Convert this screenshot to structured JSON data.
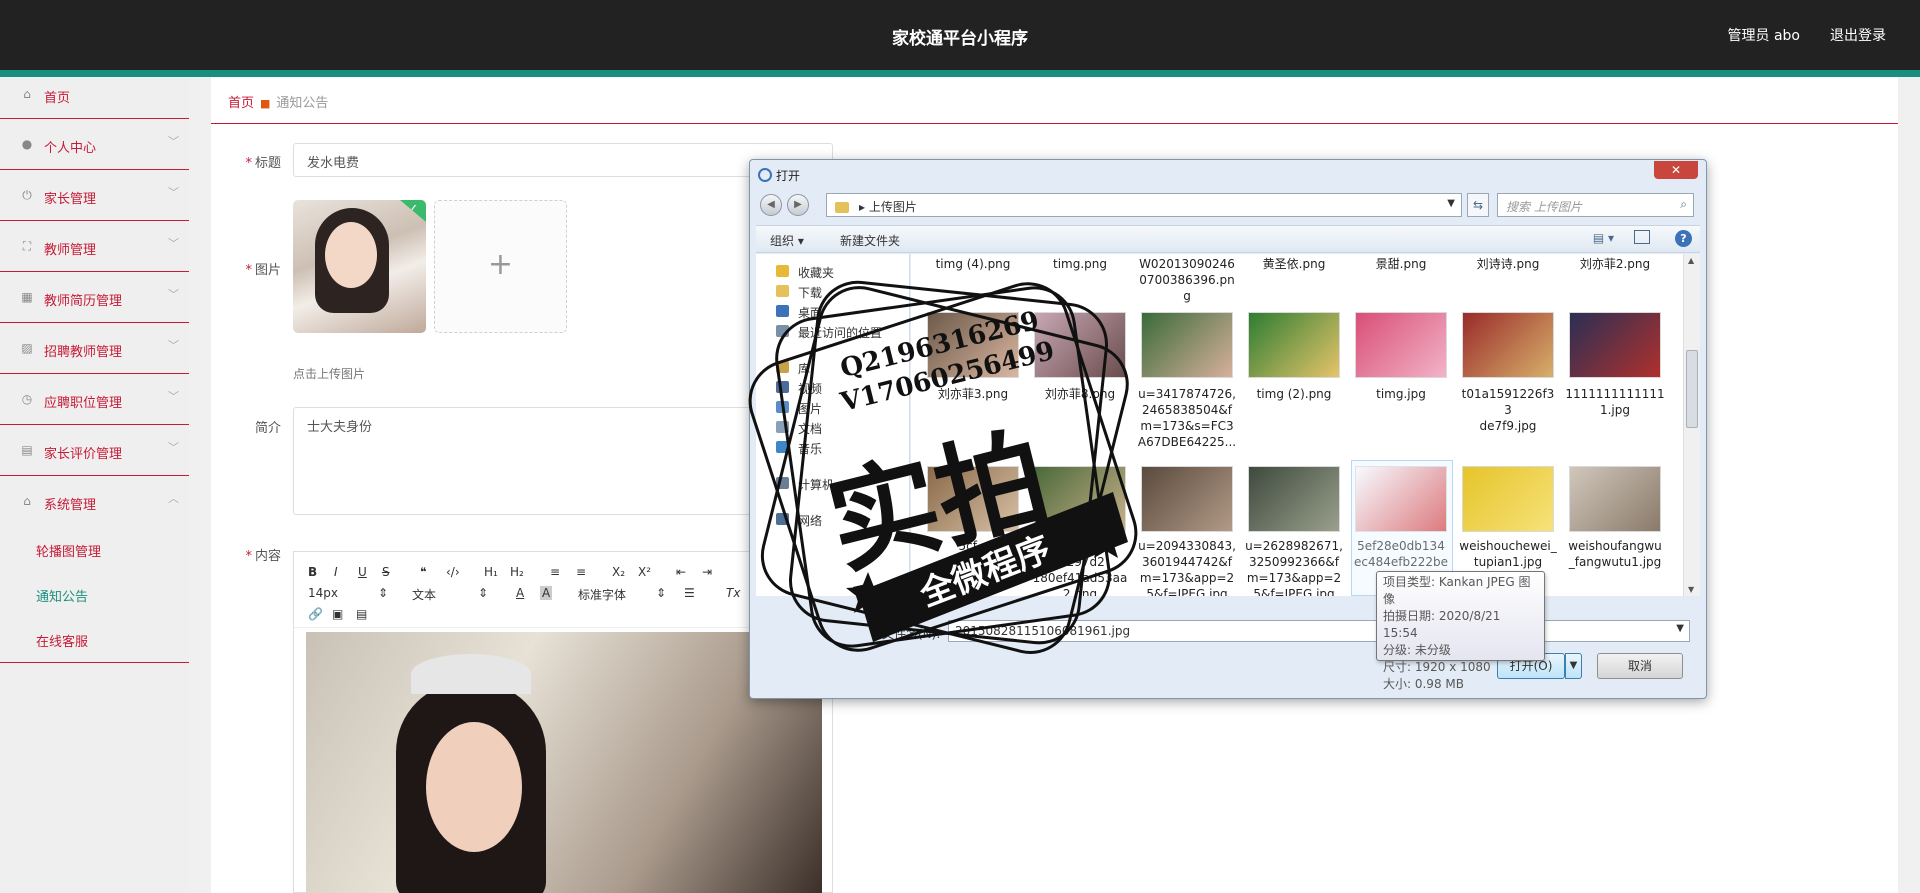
{
  "header": {
    "title": "家校通平台小程序",
    "user_label": "管理员 abo",
    "logout_label": "退出登录"
  },
  "sidebar": {
    "items": [
      {
        "label": "首页",
        "icon": "home-icon"
      },
      {
        "label": "个人中心",
        "icon": "user-icon"
      },
      {
        "label": "家长管理",
        "icon": "power-icon"
      },
      {
        "label": "教师管理",
        "icon": "expand-icon"
      },
      {
        "label": "教师简历管理",
        "icon": "grid-icon"
      },
      {
        "label": "招聘教师管理",
        "icon": "chart-icon"
      },
      {
        "label": "应聘职位管理",
        "icon": "gauge-icon"
      },
      {
        "label": "家长评价管理",
        "icon": "briefcase-icon"
      },
      {
        "label": "系统管理",
        "icon": "bank-icon"
      }
    ],
    "sub_items": [
      "轮播图管理",
      "通知公告",
      "在线客服"
    ]
  },
  "breadcrumb": {
    "home": "首页",
    "current": "通知公告"
  },
  "form": {
    "title_label": "标题",
    "title_value": "发水电费",
    "image_label": "图片",
    "upload_hint": "点击上传图片",
    "intro_label": "简介",
    "intro_value": "士大夫身份",
    "content_label": "内容",
    "toolbar": {
      "bold": "B",
      "italic": "I",
      "underline": "U",
      "strike": "S",
      "quote": "❝",
      "code": "‹/›",
      "h1": "H₁",
      "h2": "H₂",
      "ol": "≡",
      "ul": "≡",
      "sub": "X₂",
      "sup": "X²",
      "indent_dec": "⇤",
      "indent_inc": "⇥",
      "font_size": "14px",
      "text_style": "文本",
      "font_family": "标准字体",
      "clear": "Tx"
    }
  },
  "dialog": {
    "title": "打开",
    "close": "✕",
    "path": "上传图片",
    "search_placeholder": "搜索 上传图片",
    "organize": "组织 ▾",
    "new_folder": "新建文件夹",
    "nav": [
      {
        "label": "收藏夹",
        "color": "#e8b837"
      },
      {
        "label": "下载",
        "color": "#e5c15c"
      },
      {
        "label": "桌面",
        "color": "#3b72b8"
      },
      {
        "label": "最近访问的位置",
        "color": "#7a8fa8"
      },
      {
        "label": "库",
        "color": "#c7a24a"
      },
      {
        "label": "视频",
        "color": "#4c6c9c"
      },
      {
        "label": "图片",
        "color": "#5a8ccc"
      },
      {
        "label": "文档",
        "color": "#8aa0b8"
      },
      {
        "label": "音乐",
        "color": "#3e86c8"
      },
      {
        "label": "计算机",
        "color": "#6a7f94"
      },
      {
        "label": "网络",
        "color": "#4d6f96"
      }
    ],
    "files_row0": [
      "timg (4).png",
      "timg.png",
      "W02013090246\n0700386396.pn\ng",
      "黄圣依.png",
      "景甜.png",
      "刘诗诗.png",
      "刘亦菲2.png"
    ],
    "files_row1": [
      {
        "name": "刘亦菲3.png",
        "c1": "#6d5a4a",
        "c2": "#d9b6a0"
      },
      {
        "name": "刘亦菲8.png",
        "c1": "#c7a7b4",
        "c2": "#6a4d4c"
      },
      {
        "name": "u=3417874726,\n2465838504&f\nm=173&s=FC3\nA67DBE64225...",
        "c1": "#3a6b3a",
        "c2": "#d7b09b"
      },
      {
        "name": "timg (2).png",
        "c1": "#2e7d32",
        "c2": "#e6c46a"
      },
      {
        "name": "timg.jpg",
        "c1": "#d94f77",
        "c2": "#f2b3c8"
      },
      {
        "name": "t01a1591226f33\nde7f9.jpg",
        "c1": "#9a2b2b",
        "c2": "#d7b06a"
      },
      {
        "name": "1111111111111\n1.jpg",
        "c1": "#2a2f55",
        "c2": "#b0302d"
      }
    ],
    "files_row2": [
      {
        "name": "5cf...\n...png",
        "c1": "#8a6a4a",
        "c2": "#d8c1a6"
      },
      {
        "name": "a88d4c78\n...297d2\n180ef41ad53aa\n2.png",
        "c1": "#4a6a3a",
        "c2": "#c9b08a"
      },
      {
        "name": "u=2094330843,\n3601944742&f\nm=173&app=2\n5&f=JPEG.jpg",
        "c1": "#5a4a3e",
        "c2": "#b29a86"
      },
      {
        "name": "u=2628982671,\n3250992366&f\nm=173&app=2\n5&f=JPEG.jpg",
        "c1": "#3e4a3e",
        "c2": "#9aa08c"
      },
      {
        "name": "5ef28e0db134\nec484efb222be",
        "c1": "#ffffff",
        "c2": "#d83a3a"
      },
      {
        "name": "weishouchewei_\ntupian1.jpg",
        "c1": "#e6c42a",
        "c2": "#f6e27a"
      },
      {
        "name": "weishoufangwu\n_fangwutu1.jpg",
        "c1": "#d0c7bb",
        "c2": "#8a7a6a"
      }
    ],
    "filename_label": "文件名(N):",
    "filename_value": "20150828115106081961.jpg",
    "open_label": "打开(O)",
    "cancel_label": "取消",
    "tooltip": [
      "项目类型: Kankan JPEG 图像",
      "拍摄日期: 2020/8/21 15:54",
      "分级: 未分级",
      "尺寸: 1920 x 1080",
      "大小: 0.98 MB"
    ]
  },
  "watermark": {
    "line1": "Q2196316269",
    "line2": "V17060256499",
    "main": "实拍",
    "banner": "全微程序"
  }
}
